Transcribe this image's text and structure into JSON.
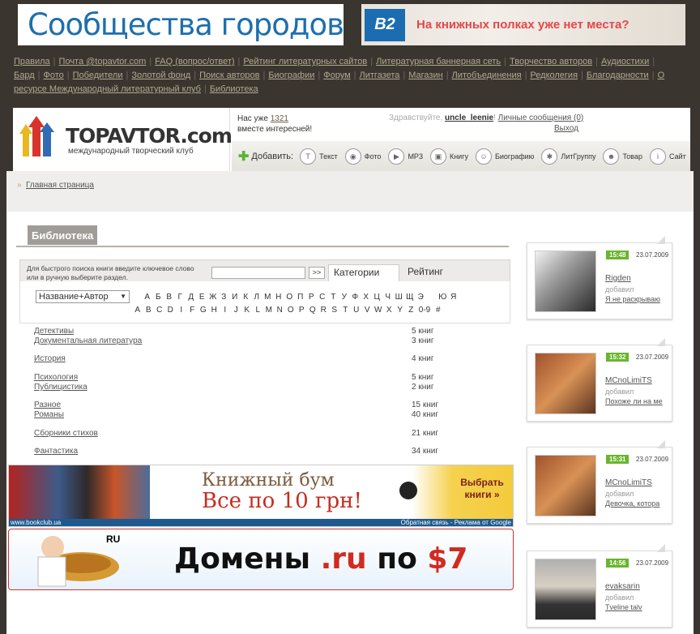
{
  "banners": {
    "communities": "Сообщества городов",
    "b2_logo": "B2",
    "shelves": "На книжных полках уже нет места?"
  },
  "nav": [
    "Правила",
    "Почта @topavtor.com",
    "FAQ (вопрос/ответ)",
    "Рейтинг литературных сайтов",
    "Литературная баннерная сеть",
    "Творчество авторов",
    "Аудиостихи",
    "Бард",
    "Фото",
    "Победители",
    "Золотой фонд",
    "Поиск авторов",
    "Биографии",
    "Форум",
    "Литгазета",
    "Магазин",
    "Литобъединения",
    "Редколегия",
    "Благодарности",
    "О ресурсе Международный литературный клуб",
    "Библиотека"
  ],
  "header": {
    "logo_title": "TOPAVTOR.com",
    "logo_sub": "международный творческий клуб",
    "members_prefix": "Нас уже ",
    "members_count": "1321",
    "members_suffix": "вместе интересней!",
    "greeting": "Здравствуйте, ",
    "username": "uncle_leenie",
    "messages": "Личные сообщения (0)",
    "logout": "Выход",
    "add_label": "Добавить:",
    "add_items": [
      "Текст",
      "Фото",
      "MP3",
      "Книгу",
      "Биографию",
      "ЛитГруппу",
      "Товар",
      "Сайт"
    ]
  },
  "breadcrumb": {
    "home": "Главная страница"
  },
  "library": {
    "title": "Библиотека",
    "search_hint_1": "Для быстрого поиска книги введите ключевое слово",
    "search_hint_2": "или в ручную выберите раздел.",
    "go": ">>",
    "tab_categories": "Категории",
    "tab_rating": "Рейтинг",
    "select_value": "Название+Автор",
    "alphabet_ru": [
      "А",
      "Б",
      "В",
      "Г",
      "Д",
      "Е",
      "Ж",
      "З",
      "И",
      "К",
      "Л",
      "М",
      "Н",
      "О",
      "П",
      "Р",
      "С",
      "Т",
      "У",
      "Ф",
      "Х",
      "Ц",
      "Ч",
      "Ш",
      "Щ",
      "Э",
      "",
      "Ю",
      "Я"
    ],
    "alphabet_en": [
      "A",
      "B",
      "C",
      "D",
      "I",
      "F",
      "G",
      "H",
      "I",
      "J",
      "K",
      "L",
      "M",
      "N",
      "O",
      "P",
      "Q",
      "R",
      "S",
      "T",
      "U",
      "V",
      "W",
      "X",
      "Y",
      "Z",
      "0-9",
      "#"
    ],
    "categories": [
      {
        "name": "Детективы",
        "count": "5 книг"
      },
      {
        "name": "Документальная литература",
        "count": "3 книг"
      },
      {
        "name": "История",
        "count": "4 книг"
      },
      {
        "name": "Психология",
        "count": "5 книг"
      },
      {
        "name": "Публицистика",
        "count": "2 книг"
      },
      {
        "name": "Разное",
        "count": "15 книг"
      },
      {
        "name": "Романы",
        "count": "40 книг"
      },
      {
        "name": "Сборники стихов",
        "count": "21 книг"
      },
      {
        "name": "Фантастика",
        "count": "34 книг"
      }
    ]
  },
  "ads": {
    "book_boom_1": "Книжный бум",
    "book_boom_2": "Все по 10 грн!",
    "choose_books": "Выбрать книги »",
    "footer_left": "www.bookclub.ua",
    "footer_right": "Обратная связь - Реклама от Google",
    "domains_1": "Домены ",
    "domains_2": ".ru",
    "domains_3": " по ",
    "domains_4": "$7",
    "ru_badge": "RU"
  },
  "activity": [
    {
      "time": "15:48",
      "date": "23.07.2009",
      "user": "Rigden",
      "action": "добавил",
      "item": "Я не раскрываю"
    },
    {
      "time": "15:32",
      "date": "23.07.2009",
      "user": "MCnoLimiTS",
      "action": "добавил",
      "item": "Похоже ли на ме"
    },
    {
      "time": "15:31",
      "date": "23.07.2009",
      "user": "MCnoLimiTS",
      "action": "добавил",
      "item": "Девочка, котора"
    },
    {
      "time": "14:56",
      "date": "23.07.2009",
      "user": "evaksarin",
      "action": "добавил",
      "item": "Tveline talv"
    }
  ]
}
